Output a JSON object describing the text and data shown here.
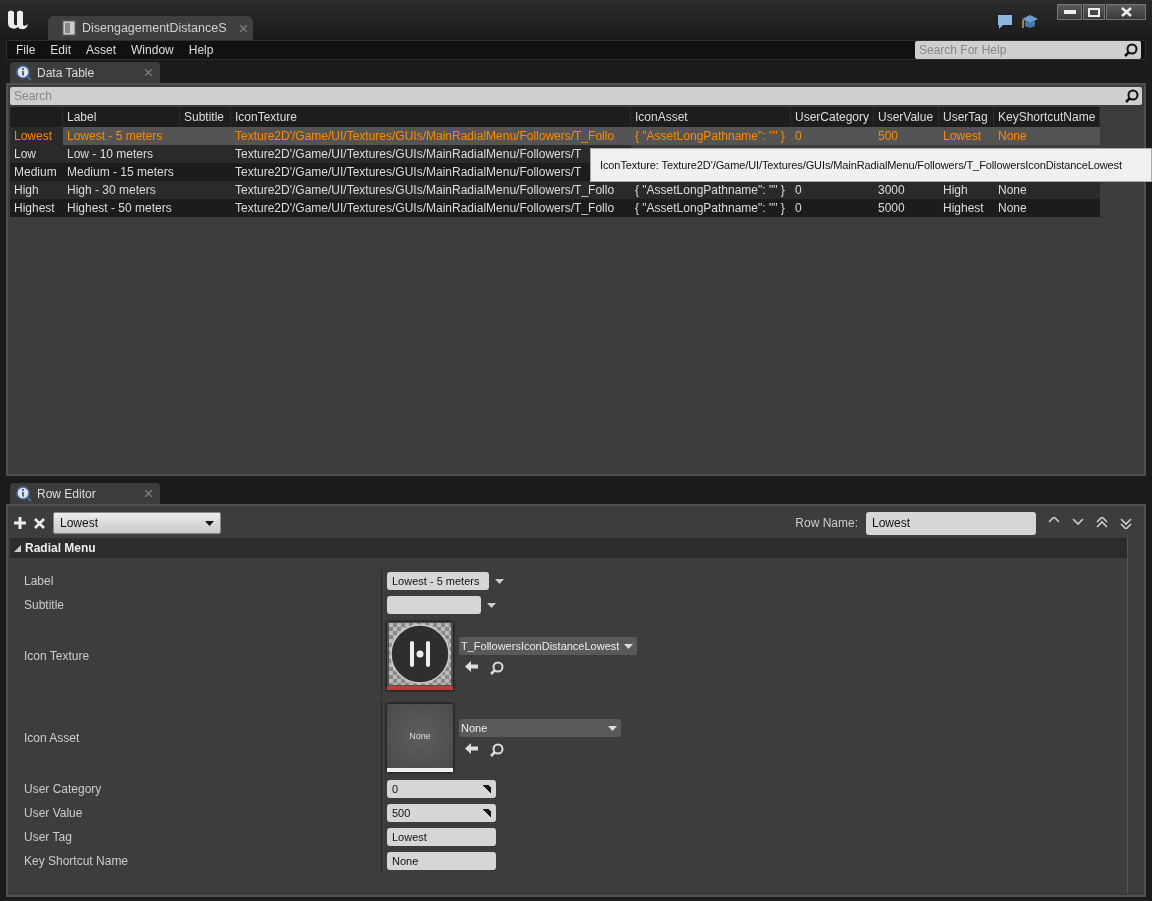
{
  "window": {
    "document_tab": "DisengagementDistanceS",
    "menu": [
      "File",
      "Edit",
      "Asset",
      "Window",
      "Help"
    ],
    "help_search": {
      "placeholder": "Search For Help"
    }
  },
  "data_table": {
    "tab": "Data Table",
    "search": {
      "placeholder": "Search"
    },
    "columns": [
      "Label",
      "Subtitle",
      "IconTexture",
      "IconAsset",
      "UserCategory",
      "UserValue",
      "UserTag",
      "KeyShortcutName"
    ],
    "rows": [
      {
        "selected": true,
        "name": "Lowest",
        "cells": [
          "Lowest - 5 meters",
          null,
          "Texture2D'/Game/UI/Textures/GUIs/MainRadialMenu/Followers/T_Follo",
          "{ \"AssetLongPathname\": \"\" }",
          "0",
          "500",
          "Lowest",
          "None"
        ]
      },
      {
        "selected": false,
        "name": "Low",
        "cells": [
          "Low - 10 meters",
          null,
          "Texture2D'/Game/UI/Textures/GUIs/MainRadialMenu/Followers/T"
        ]
      },
      {
        "selected": false,
        "name": "Medium",
        "cells": [
          "Medium - 15 meters",
          null,
          "Texture2D'/Game/UI/Textures/GUIs/MainRadialMenu/Followers/T"
        ]
      },
      {
        "selected": false,
        "name": "High",
        "cells": [
          "High - 30 meters",
          null,
          "Texture2D'/Game/UI/Textures/GUIs/MainRadialMenu/Followers/T_Follo",
          "{ \"AssetLongPathname\": \"\" }",
          "0",
          "3000",
          "High",
          "None"
        ]
      },
      {
        "selected": false,
        "name": "Highest",
        "cells": [
          "Highest - 50 meters",
          null,
          "Texture2D'/Game/UI/Textures/GUIs/MainRadialMenu/Followers/T_Follo",
          "{ \"AssetLongPathname\": \"\" }",
          "0",
          "5000",
          "Highest",
          "None"
        ]
      }
    ],
    "tooltip": "IconTexture: Texture2D'/Game/UI/Textures/GUIs/MainRadialMenu/Followers/T_FollowersIconDistanceLowest"
  },
  "row_editor": {
    "tab": "Row Editor",
    "row_select": "Lowest",
    "row_name_label": "Row Name:",
    "row_name": "Lowest",
    "category": "Radial Menu",
    "expanded": true,
    "properties": [
      {
        "kind": "combo",
        "label": "Label",
        "value": "Lowest - 5 meters"
      },
      {
        "kind": "combo",
        "label": "Subtitle"
      },
      {
        "kind": "texture",
        "label": "Icon Texture",
        "value": "T_FollowersIconDistanceLowest"
      },
      {
        "kind": "asset",
        "label": "Icon Asset",
        "value": "None",
        "thumbnail": "None"
      },
      {
        "kind": "number",
        "label": "User Category",
        "value": "0"
      },
      {
        "kind": "number",
        "label": "User Value",
        "value": "500"
      },
      {
        "kind": "text",
        "label": "User Tag",
        "value": "Lowest"
      },
      {
        "kind": "text",
        "label": "Key Shortcut Name",
        "value": "None"
      }
    ]
  }
}
